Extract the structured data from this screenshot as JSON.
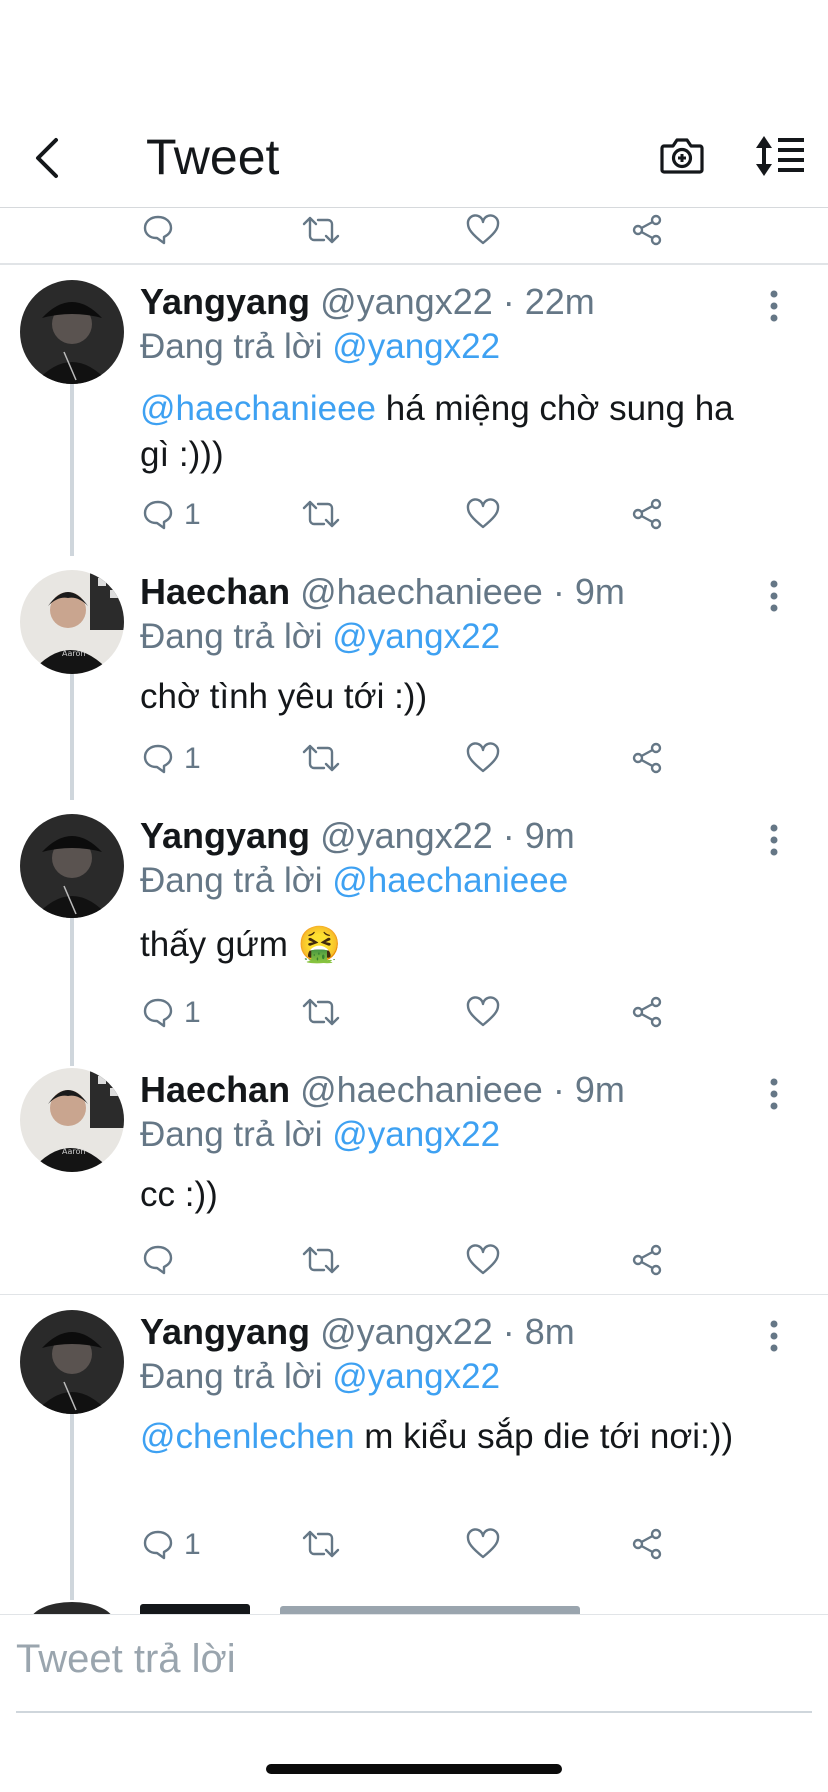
{
  "nav": {
    "title": "Tweet"
  },
  "tweets": [
    {
      "name": "Yangyang",
      "handle": "@yangx22",
      "time": "· 22m",
      "reply_prefix": "Đang trả lời ",
      "reply_to": "@yangx22",
      "mention": "@haechanieee",
      "text": " há miệng chờ sung ha gì :)))",
      "reply_count": "1"
    },
    {
      "name": "Haechan",
      "handle": "@haechanieee",
      "time": "· 9m",
      "reply_prefix": "Đang trả lời ",
      "reply_to": "@yangx22",
      "mention": "",
      "text": "chờ tình yêu tới :))",
      "reply_count": "1"
    },
    {
      "name": "Yangyang",
      "handle": "@yangx22",
      "time": "· 9m",
      "reply_prefix": "Đang trả lời ",
      "reply_to": "@haechanieee",
      "mention": "",
      "text": "thấy gứm 🤮",
      "reply_count": "1"
    },
    {
      "name": "Haechan",
      "handle": "@haechanieee",
      "time": "· 9m",
      "reply_prefix": "Đang trả lời ",
      "reply_to": "@yangx22",
      "mention": "",
      "text": "cc :))",
      "reply_count": ""
    },
    {
      "name": "Yangyang",
      "handle": "@yangx22",
      "time": "· 8m",
      "reply_prefix": "Đang trả lời ",
      "reply_to": "@yangx22",
      "mention": "@chenlechen",
      "text": " m kiểu sắp die tới nơi:))",
      "reply_count": "1"
    }
  ],
  "composer": {
    "placeholder": "Tweet trả lời"
  },
  "colors": {
    "link": "#3ea1f2",
    "meta": "#657786",
    "text": "#14171a"
  }
}
